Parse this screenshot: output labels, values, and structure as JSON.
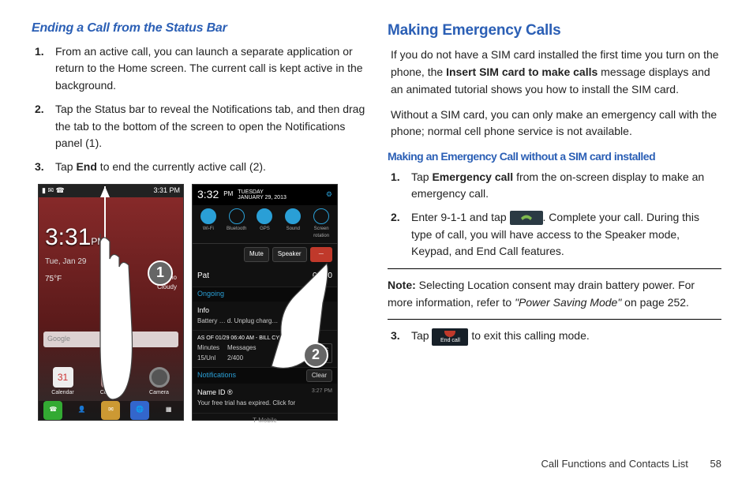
{
  "left": {
    "heading": "Ending a Call from the Status Bar",
    "steps": {
      "s1": "From an active call, you can launch a separate application or return to the Home screen. The current call is kept active in the background.",
      "s2": "Tap the Status bar to reveal the Notifications tab, and then drag the tab to the bottom of the screen to open the Notifications panel (1).",
      "s3_pre": "Tap ",
      "s3_bold": "End",
      "s3_post": " to end the currently active call (2)."
    },
    "phone1": {
      "status_time": "3:31 PM",
      "clock": "3:31",
      "pm": "PM",
      "date": "Tue, Jan 29",
      "temp": "75°F",
      "weather": "Plano\nCloudy",
      "google": "Google",
      "dock": {
        "cal": "31",
        "cal_lbl": "Calendar",
        "contacts": "Contacts",
        "camera": "Camera"
      },
      "nav": {
        "phone": "Phone",
        "contacts": "Contacts",
        "msg": "Messaging",
        "internet": "Internet",
        "apps": "Apps"
      }
    },
    "phone2": {
      "time": "3:32",
      "pm": "PM",
      "dow": "TUESDAY",
      "date": "JANUARY 29, 2013",
      "toggles": {
        "wifi": "Wi-Fi",
        "bt": "Bluetooth",
        "gps": "GPS",
        "sound": "Sound",
        "rotate": "Screen rotation"
      },
      "mute": "Mute",
      "speaker": "Speaker",
      "caller": "Pat",
      "calltime": "04:40",
      "ongoing": "Ongoing",
      "info_title": "Info",
      "info_body": "Battery … d. Unplug charg…",
      "bill_title": "AS OF 01/29 06:40 AM - BILL CYCL…",
      "bill_min": "Minutes",
      "bill_msg": "Messages",
      "bill_min_v": "15/Unl",
      "bill_msg_v": "2/400",
      "myac": "My Ac",
      "notifications": "Notifications",
      "clear": "Clear",
      "nameid_title": "Name ID ®",
      "nameid_body": "Your free trial has expired. Click for",
      "nameid_time": "3:27 PM",
      "carrier": "T-Mobile"
    },
    "badge1": "1",
    "badge2": "2"
  },
  "right": {
    "heading": "Making Emergency Calls",
    "p1_pre": "If you do not have a SIM card installed the first time you turn on the phone, the ",
    "p1_bold": "Insert SIM card to make calls",
    "p1_post": " message displays and an animated tutorial shows you how to install the SIM card.",
    "p2": "Without a SIM card, you can only make an emergency call with the phone; normal cell phone service is not available.",
    "subheading": "Making an Emergency Call without a SIM card installed",
    "steps": {
      "s1_pre": "Tap ",
      "s1_bold": "Emergency call",
      "s1_post": " from the on-screen display to make an emergency call.",
      "s2_pre": "Enter 9-1-1 and tap ",
      "s2_post": ". Complete your call. During this type of call, you will have access to the Speaker mode, Keypad, and End Call features."
    },
    "note_label": "Note:",
    "note_body_pre": "Selecting Location consent may drain battery power. For more information, refer to ",
    "note_body_ital": "\"Power Saving Mode\"",
    "note_body_post": "  on page 252.",
    "s3_pre": "Tap ",
    "s3_post": " to exit this calling mode.",
    "endcall_label": "End call",
    "footer_text": "Call Functions and Contacts List",
    "page_number": "58"
  }
}
